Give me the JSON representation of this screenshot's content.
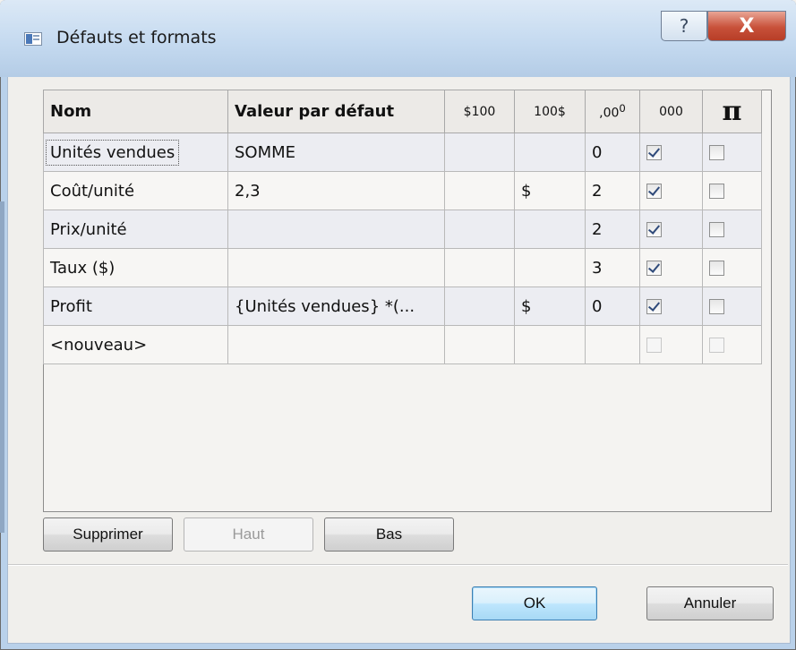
{
  "window": {
    "title": "Défauts et formats",
    "help_glyph": "?",
    "close_glyph": "X"
  },
  "grid": {
    "headers": {
      "nom": "Nom",
      "valeur": "Valeur par défaut",
      "prefix_currency": "$100",
      "suffix_currency": "100$",
      "decimals": ",00",
      "decimals_sup": "0",
      "thousands": "000",
      "pi": "π"
    },
    "rows": [
      {
        "nom": "Unités vendues",
        "valeur": "SOMME",
        "prefix": "",
        "suffix": "",
        "decimals": "0",
        "thousands": true,
        "pi": false
      },
      {
        "nom": "Coût/unité",
        "valeur": "2,3",
        "prefix": "",
        "suffix": "$",
        "decimals": "2",
        "thousands": true,
        "pi": false
      },
      {
        "nom": "Prix/unité",
        "valeur": "",
        "prefix": "",
        "suffix": "",
        "decimals": "2",
        "thousands": true,
        "pi": false
      },
      {
        "nom": "Taux ($)",
        "valeur": "",
        "prefix": "",
        "suffix": "",
        "decimals": "3",
        "thousands": true,
        "pi": false
      },
      {
        "nom": "Profit",
        "valeur": "{Unités vendues} *(...",
        "prefix": "",
        "suffix": "$",
        "decimals": "0",
        "thousands": true,
        "pi": false
      },
      {
        "nom": "<nouveau>",
        "valeur": "",
        "prefix": "",
        "suffix": "",
        "decimals": "",
        "thousands": false,
        "pi": false
      }
    ]
  },
  "buttons": {
    "supprimer": "Supprimer",
    "haut": "Haut",
    "bas": "Bas",
    "ok": "OK",
    "annuler": "Annuler"
  },
  "colors": {
    "titlebar": "#c5daf0",
    "close_button": "#c8513a",
    "default_button_border": "#3c7fb1",
    "checkbox_check": "#2f4a7a"
  },
  "icons": {
    "app": "window-icon",
    "help": "help-icon",
    "close": "close-icon",
    "checkbox": "checkbox-icon"
  }
}
